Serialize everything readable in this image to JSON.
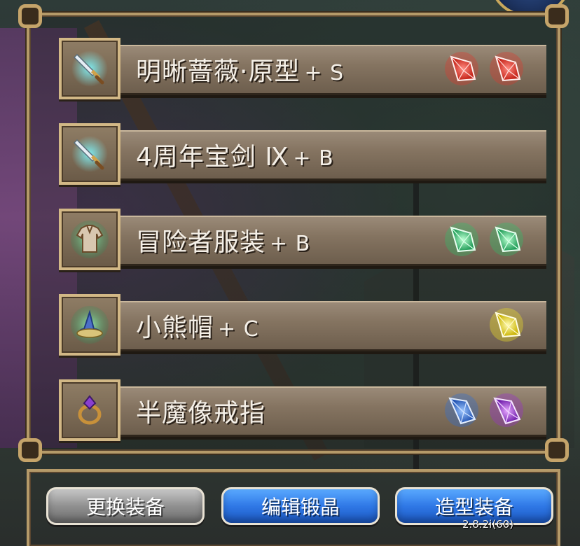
{
  "equipment": [
    {
      "name": "明晰蔷薇·原型",
      "grade": "+ S",
      "icon": "sword-icon",
      "gems": [
        "#e03a2e",
        "#e03a2e"
      ]
    },
    {
      "name": "4周年宝剑 Ⅸ",
      "grade": "+ B",
      "icon": "sword-icon",
      "gems": []
    },
    {
      "name": "冒险者服装",
      "grade": "+ B",
      "icon": "armor-icon",
      "gems": [
        "#2fbf6a",
        "#2fbf6a"
      ]
    },
    {
      "name": "小熊帽",
      "grade": "+ C",
      "icon": "hat-icon",
      "gems": [
        "#e6d82a"
      ]
    },
    {
      "name": "半魔像戒指",
      "grade": "",
      "icon": "ring-icon",
      "gems": [
        "#2f6fd8",
        "#9a2fd0"
      ]
    }
  ],
  "buttons": {
    "change_equipment": "更换装备",
    "edit_crystal": "编辑锻晶",
    "style_equipment": "造型装备"
  },
  "version": "2.8.2i(60)"
}
